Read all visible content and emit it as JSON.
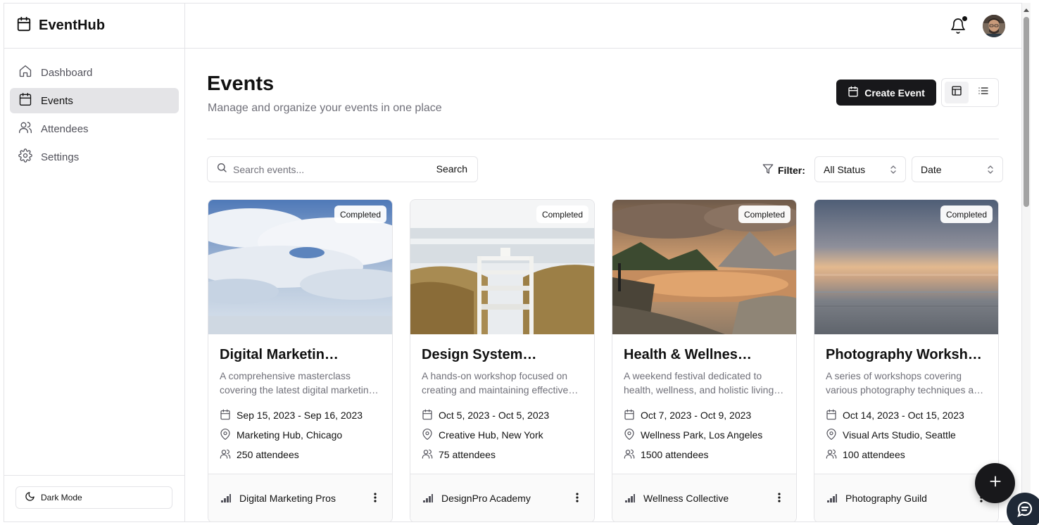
{
  "app": {
    "name": "EventHub"
  },
  "sidebar": {
    "items": [
      {
        "label": "Dashboard",
        "icon": "home-icon",
        "active": false
      },
      {
        "label": "Events",
        "icon": "calendar-icon",
        "active": true
      },
      {
        "label": "Attendees",
        "icon": "users-icon",
        "active": false
      },
      {
        "label": "Settings",
        "icon": "gear-icon",
        "active": false
      }
    ],
    "dark_mode_label": "Dark Mode"
  },
  "header": {
    "title": "Events",
    "subtitle": "Manage and organize your events in one place",
    "create_label": "Create Event"
  },
  "toolbar": {
    "search_placeholder": "Search events...",
    "search_button": "Search",
    "filter_label": "Filter:",
    "status_select": "All Status",
    "sort_select": "Date"
  },
  "events": [
    {
      "status": "Completed",
      "title": "Digital Marketing Masterclass",
      "description": "A comprehensive masterclass covering the latest digital marketing strategies",
      "dates": "Sep 15, 2023 - Sep 16, 2023",
      "location": "Marketing Hub, Chicago",
      "attendees": "250 attendees",
      "organizer": "Digital Marketing Pros",
      "image": "sky-clouds"
    },
    {
      "status": "Completed",
      "title": "Design Systems Workshop",
      "description": "A hands-on workshop focused on creating and maintaining effective design systems",
      "dates": "Oct 5, 2023 - Oct 5, 2023",
      "location": "Creative Hub, New York",
      "attendees": "75 attendees",
      "organizer": "DesignPro Academy",
      "image": "beach-lifeguard-chair"
    },
    {
      "status": "Completed",
      "title": "Health & Wellness Festival",
      "description": "A weekend festival dedicated to health, wellness, and holistic living practices",
      "dates": "Oct 7, 2023 - Oct 9, 2023",
      "location": "Wellness Park, Los Angeles",
      "attendees": "1500 attendees",
      "organizer": "Wellness Collective",
      "image": "mountain-lake"
    },
    {
      "status": "Completed",
      "title": "Photography Workshop Series",
      "description": "A series of workshops covering various photography techniques and styles",
      "dates": "Oct 14, 2023 - Oct 15, 2023",
      "location": "Visual Arts Studio, Seattle",
      "attendees": "100 attendees",
      "organizer": "Photography Guild",
      "image": "sea-sunset"
    }
  ],
  "colors": {
    "primary": "#18181b",
    "muted_text": "#71717a",
    "border": "#e4e4e7",
    "active_nav": "#e4e4e7"
  }
}
